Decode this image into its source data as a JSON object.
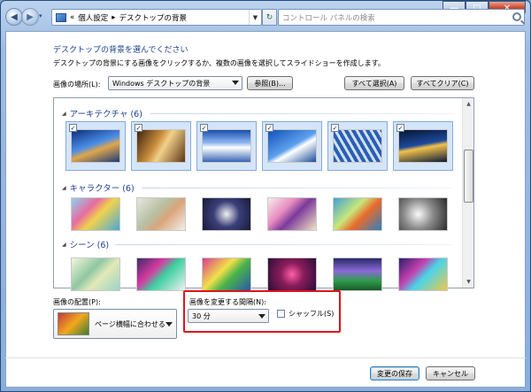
{
  "titlebar": {
    "minimize": "—",
    "maximize": "□",
    "close": "✕"
  },
  "address": {
    "root_chevron": "«",
    "crumb1": "個人設定",
    "sep": "▸",
    "crumb2": "デスクトップの背景",
    "search_placeholder": "コントロール パネルの検索"
  },
  "page": {
    "heading": "デスクトップの背景を選んでください",
    "description": "デスクトップの背景にする画像をクリックするか、複数の画像を選択してスライドショーを作成します。",
    "location_label": "画像の場所(L):",
    "location_value": "Windows デスクトップの背景",
    "browse_button": "参照(B)...",
    "select_all_button": "すべて選択(A)",
    "clear_all_button": "すべてクリア(C)"
  },
  "gallery": {
    "groups": [
      {
        "title": "アーキテクチャ (6)",
        "selected": true,
        "checks": [
          "✓",
          "✓",
          "✓",
          "✓",
          "✓",
          "✓"
        ]
      },
      {
        "title": "キャラクター (6)",
        "selected": false
      },
      {
        "title": "シーン (6)",
        "selected": false
      }
    ]
  },
  "options": {
    "position_label": "画像の配置(P):",
    "position_value": "ページ横幅に合わせる",
    "interval_label": "画像を変更する間隔(N):",
    "interval_value": "30 分",
    "shuffle_label": "シャッフル(S)",
    "shuffle_checked": false
  },
  "footer": {
    "save_button": "変更の保存",
    "cancel_button": "キャンセル"
  },
  "colors": {
    "highlight_box": "#e0141b",
    "heading": "#1e3f8f",
    "selection": "#d5e5f8"
  }
}
